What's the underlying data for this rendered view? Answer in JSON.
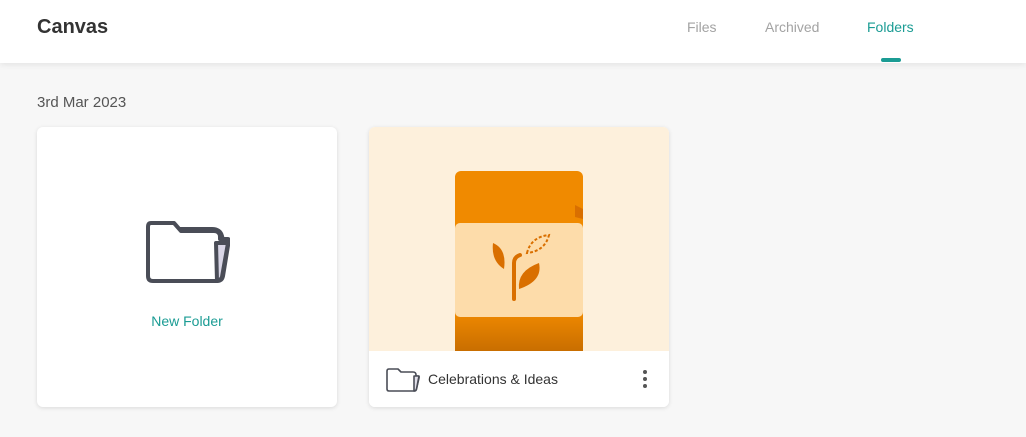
{
  "header": {
    "title": "Canvas",
    "tabs": [
      {
        "label": "Files",
        "active": false
      },
      {
        "label": "Archived",
        "active": false
      },
      {
        "label": "Folders",
        "active": true
      }
    ]
  },
  "main": {
    "date_heading": "3rd Mar 2023",
    "new_folder_card": {
      "label": "New Folder",
      "icon": "folder-icon"
    },
    "folders": [
      {
        "name": "Celebrations & Ideas",
        "icon": "folder-icon",
        "thumbnail": "journal-sprout-illustration"
      }
    ]
  },
  "colors": {
    "accent": "#1b9c94",
    "thumbnail_background": "#fdf0dc",
    "journal_orange": "#f08a00"
  }
}
